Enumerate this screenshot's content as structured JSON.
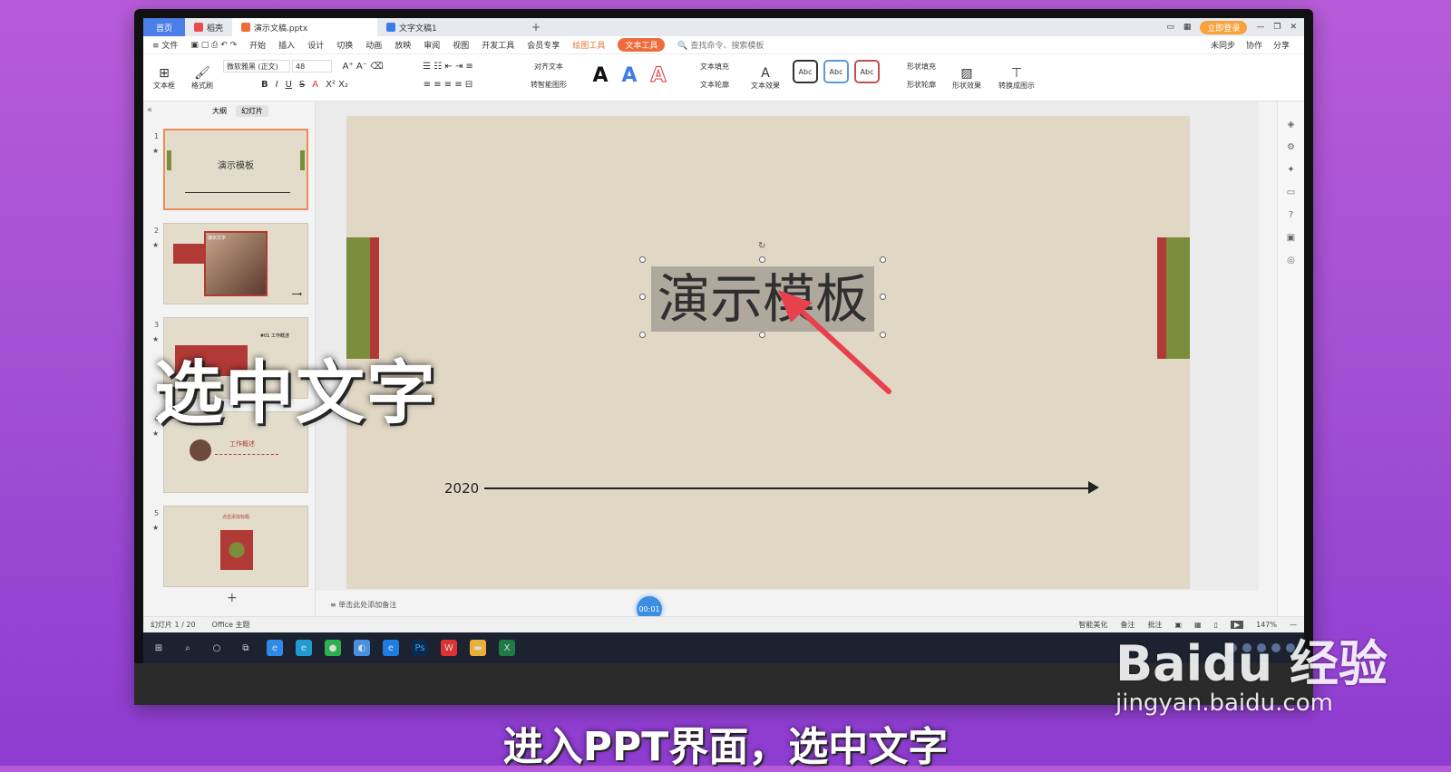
{
  "tabs": [
    {
      "label": "首页"
    },
    {
      "label": "稻壳"
    },
    {
      "label": "演示文稿.pptx"
    },
    {
      "label": "文字文稿1"
    }
  ],
  "tab_add": "+",
  "login_button": "立即登录",
  "menu": {
    "file": "文件",
    "items": [
      "开始",
      "插入",
      "设计",
      "切换",
      "动画",
      "放映",
      "审阅",
      "视图",
      "开发工具",
      "会员专享"
    ],
    "draw_tools": "绘图工具",
    "text_tools": "文本工具",
    "search": "查找命令、搜索模板",
    "right": [
      "未同步",
      "协作",
      "分享"
    ]
  },
  "ribbon": {
    "textbox": "文本框",
    "format_painter": "格式刷",
    "font_name": "微软雅黑 (正文)",
    "font_size": "48",
    "align_text": "对齐文本",
    "smart_shape": "转智能图形",
    "text_fill": "文本填充",
    "text_outline": "文本轮廓",
    "text_effect": "文本效果",
    "abc": [
      "Abc",
      "Abc",
      "Abc"
    ],
    "shape_fill": "形状填充",
    "shape_outline": "形状轮廓",
    "shape_effect": "形状效果",
    "convert_graphic": "转换成图示"
  },
  "left_panel": {
    "tab_outline": "大纲",
    "tab_slides": "幻灯片",
    "thumbs": [
      {
        "num": "1",
        "title": "演示模板"
      },
      {
        "num": "2",
        "title": "演示文字"
      },
      {
        "num": "3",
        "title": "#01 工作概述"
      },
      {
        "num": "4",
        "title": "工作概述"
      },
      {
        "num": "5",
        "title": "点击添加标题"
      }
    ],
    "add": "+"
  },
  "slide": {
    "title": "演示模板",
    "year": "2020"
  },
  "notes_placeholder": "单击此处添加备注",
  "timer": "00:01",
  "status": {
    "slide_count": "幻灯片 1 / 20",
    "theme": "Office 主题",
    "beautify": "智能美化",
    "notes": "备注",
    "comments": "批注",
    "zoom": "147%"
  },
  "overlay_text": "选中文字",
  "subtitle": "进入PPT界面，选中文字",
  "watermark": {
    "main": "Baidu 经验",
    "sub": "jingyan.baidu.com"
  },
  "colors": {
    "accent": "#e4753a",
    "slide_bg": "#e0d7c4",
    "bar_green": "#7b8c3a",
    "bar_red": "#b23a36",
    "arrow": "#e8404d"
  }
}
